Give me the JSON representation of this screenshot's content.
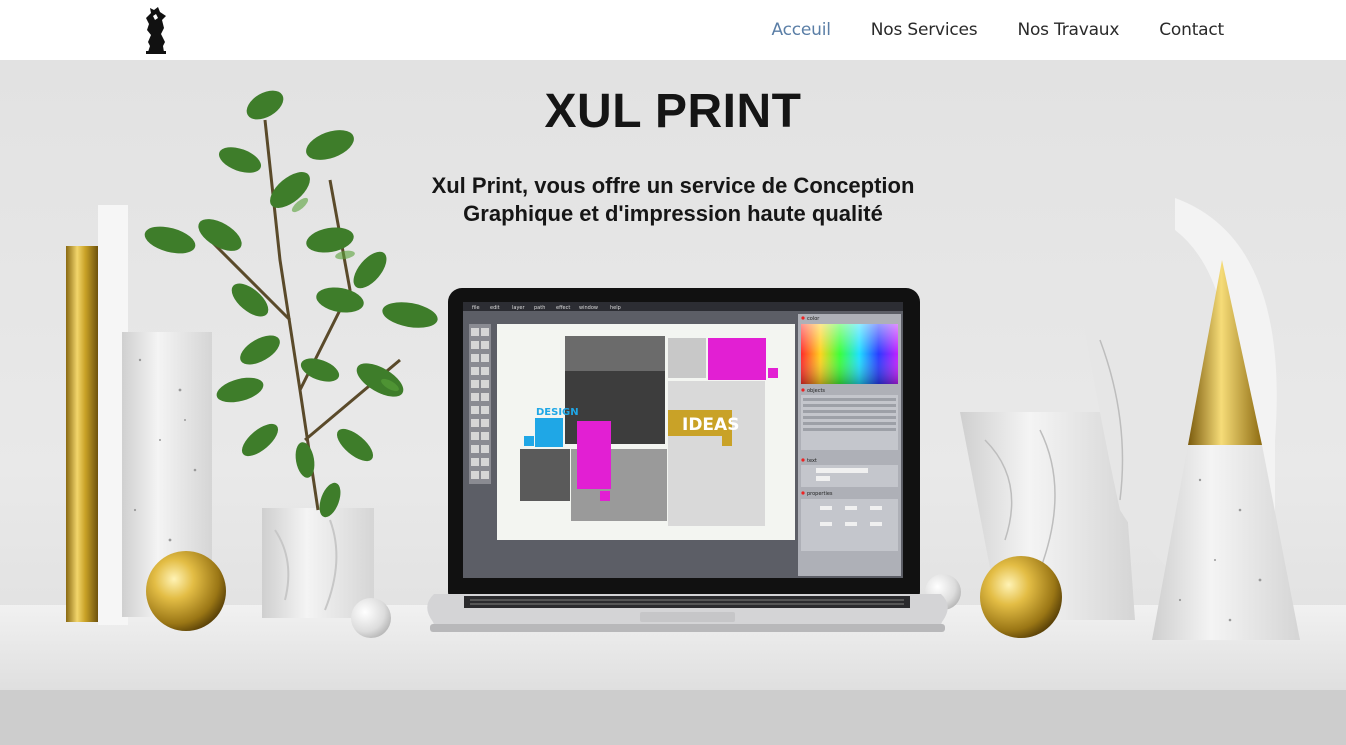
{
  "header": {
    "logo_alt": "XUL PRINT",
    "logo_text": "XUL",
    "nav": [
      {
        "label": "Acceuil",
        "active": true
      },
      {
        "label": "Nos Services",
        "active": false
      },
      {
        "label": "Nos Travaux",
        "active": false
      },
      {
        "label": "Contact",
        "active": false
      }
    ],
    "active_color": "#5a7ea6"
  },
  "hero": {
    "title": "XUL PRINT",
    "subtitle": "Xul Print, vous offre un service de Conception Graphique et d'impression haute qualité",
    "screen": {
      "menu": [
        "file",
        "edit",
        "layer",
        "path",
        "effect",
        "window",
        "help"
      ],
      "panels": [
        "color",
        "objects",
        "text",
        "properties"
      ],
      "word_design": "DESIGN",
      "word_ideas": "IDEAS"
    }
  },
  "colors": {
    "magenta": "#e21fd3",
    "cyan": "#1fa7e6",
    "gold": "#c9a227",
    "text_dark": "#151515"
  }
}
